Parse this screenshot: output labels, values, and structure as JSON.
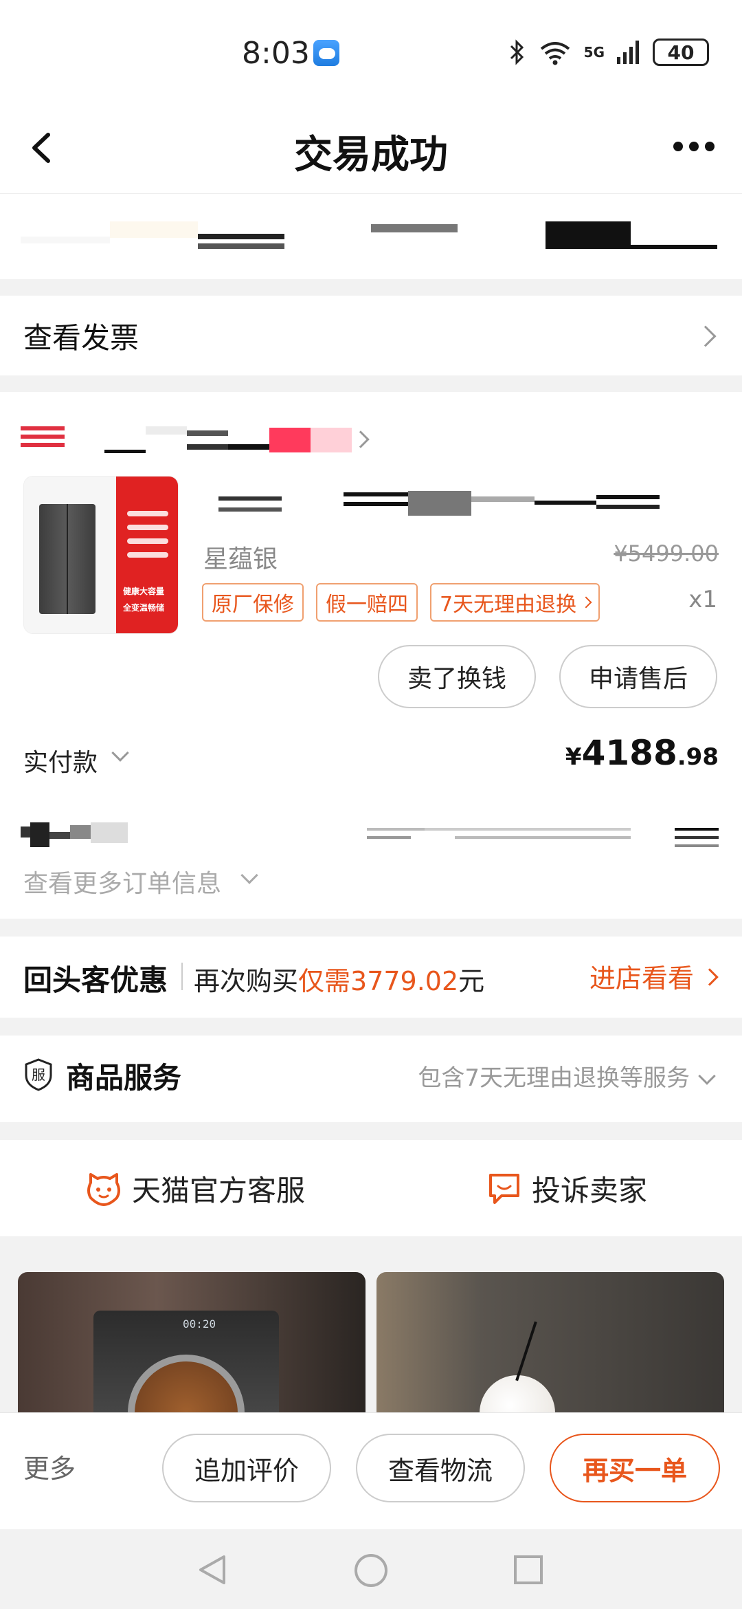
{
  "status_bar": {
    "time": "8:03",
    "network": "5G",
    "battery": "40"
  },
  "header": {
    "title": "交易成功"
  },
  "invoice": {
    "label": "查看发票"
  },
  "product": {
    "variant": "星蕴银",
    "original_price": "¥5499.00",
    "tags": [
      "原厂保修",
      "假一赔四",
      "7天无理由退换"
    ],
    "quantity": "x1",
    "thumb_captions": [
      "健康大容量",
      "全变温畅储"
    ],
    "actions": {
      "sell_label": "卖了换钱",
      "after_sales_label": "申请售后"
    }
  },
  "payment": {
    "label": "实付款",
    "currency": "¥",
    "amount_int": "4188",
    "amount_dec": ".98",
    "more_info": "查看更多订单信息"
  },
  "promo": {
    "title": "回头客优惠",
    "text_prefix": "再次购买",
    "highlight": "仅需3779.02",
    "text_suffix": "元",
    "link": "进店看看"
  },
  "services": {
    "icon_char": "服",
    "title": "商品服务",
    "desc": "包含7天无理由退换等服务"
  },
  "customer_service": {
    "official_label": "天猫官方客服",
    "complain_label": "投诉卖家"
  },
  "recommendations": {
    "washer_display": "00:20"
  },
  "bottom_bar": {
    "more": "更多",
    "review": "追加评价",
    "logistics": "查看物流",
    "rebuy": "再买一单"
  },
  "colors": {
    "accent": "#e8561c",
    "price_red": "#e02222"
  }
}
